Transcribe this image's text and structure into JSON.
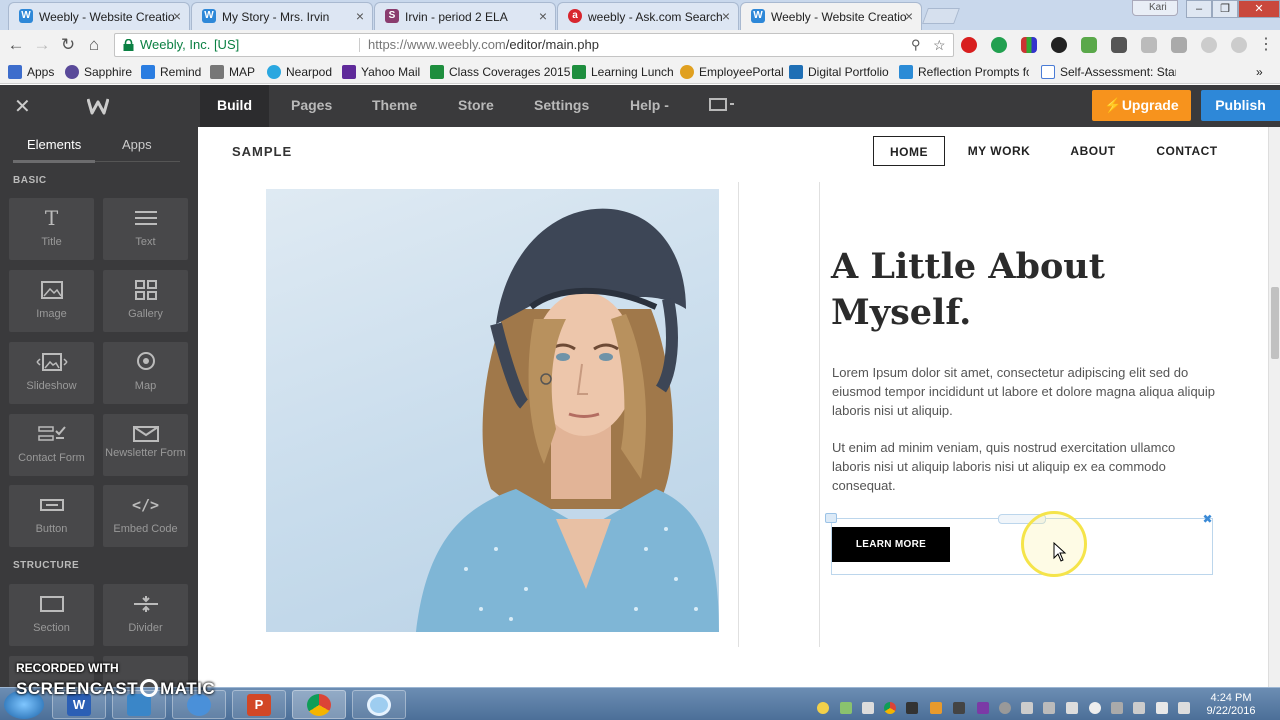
{
  "browser": {
    "tabs": [
      {
        "title": "Weebly - Website Creatio",
        "favicon": "weebly-favicon",
        "color": "#2e88d8"
      },
      {
        "title": "My Story - Mrs. Irvin",
        "favicon": "weebly-favicon",
        "color": "#2e88d8"
      },
      {
        "title": "Irvin - period 2 ELA",
        "favicon": "schoology-favicon",
        "color": "#8a3c6e"
      },
      {
        "title": "weebly - Ask.com Search",
        "favicon": "ask-favicon",
        "color": "#d8262e"
      },
      {
        "title": "Weebly - Website Creatio",
        "favicon": "weebly-favicon",
        "color": "#2e88d8"
      }
    ],
    "user_label": "Kari",
    "address": {
      "secure_label": "Weebly, Inc. [US]",
      "url_base": "https://www.weebly.com",
      "url_path": "/editor/main.php"
    },
    "bookmarks": [
      {
        "label": "Apps",
        "icon": "apps-grid-icon",
        "color": "#3d6dcc"
      },
      {
        "label": "Sapphire",
        "icon": "sapphire-icon",
        "color": "#5a4a9a"
      },
      {
        "label": "Remind",
        "icon": "remind-icon",
        "color": "#2a7de1"
      },
      {
        "label": "MAP",
        "icon": "map-bars-icon",
        "color": "#777777"
      },
      {
        "label": "Nearpod",
        "icon": "nearpod-icon",
        "color": "#2aa7e0"
      },
      {
        "label": "Yahoo Mail",
        "icon": "yahoo-mail-icon",
        "color": "#5f2a9a"
      },
      {
        "label": "Class Coverages 2015",
        "icon": "sheets-icon",
        "color": "#1e8e3e"
      },
      {
        "label": "Learning Lunch",
        "icon": "sheets-icon",
        "color": "#1e8e3e"
      },
      {
        "label": "EmployeePortal",
        "icon": "portal-icon",
        "color": "#e0a020"
      },
      {
        "label": "Digital Portfolio",
        "icon": "portfolio-icon",
        "color": "#1f6fb5"
      },
      {
        "label": "Reflection Prompts fo",
        "icon": "prompts-icon",
        "color": "#2b8bd6"
      },
      {
        "label": "Self-Assessment: Stan",
        "icon": "doc-icon",
        "color": "#4a7cd6"
      }
    ]
  },
  "editor": {
    "nav": [
      "Build",
      "Pages",
      "Theme",
      "Store",
      "Settings",
      "Help -"
    ],
    "upgrade_label": "Upgrade",
    "publish_label": "Publish"
  },
  "sidebar": {
    "tabs": [
      "Elements",
      "Apps"
    ],
    "sections": {
      "basic": "BASIC",
      "structure": "STRUCTURE"
    },
    "basic_items": [
      {
        "label": "Title",
        "icon": "title-icon"
      },
      {
        "label": "Text",
        "icon": "text-lines-icon"
      },
      {
        "label": "Image",
        "icon": "image-icon"
      },
      {
        "label": "Gallery",
        "icon": "gallery-icon"
      },
      {
        "label": "Slideshow",
        "icon": "slideshow-icon"
      },
      {
        "label": "Map",
        "icon": "map-pin-icon"
      },
      {
        "label": "Contact Form",
        "icon": "contact-form-icon"
      },
      {
        "label": "Newsletter Form",
        "icon": "envelope-icon"
      },
      {
        "label": "Button",
        "icon": "button-icon"
      },
      {
        "label": "Embed Code",
        "icon": "code-icon"
      }
    ],
    "structure_items": [
      {
        "label": "Section",
        "icon": "section-icon"
      },
      {
        "label": "Divider",
        "icon": "divider-icon"
      }
    ]
  },
  "site": {
    "title": "SAMPLE",
    "nav": [
      "HOME",
      "MY WORK",
      "ABOUT",
      "CONTACT"
    ],
    "heading": "A Little About Myself.",
    "paragraph1": "Lorem Ipsum dolor sit amet, consectetur adipiscing elit sed do eiusmod tempor incididunt ut labore et dolore magna aliqua aliquip laboris nisi ut aliquip.",
    "paragraph2": "Ut enim ad minim veniam, quis nostrud exercitation ullamco laboris nisi ut aliquip laboris nisi ut aliquip ex ea commodo consequat.",
    "button_label": "LEARN MORE"
  },
  "taskbar": {
    "time": "4:24 PM",
    "date": "9/22/2016"
  },
  "watermark": {
    "line1": "RECORDED WITH",
    "line2a": "SCREENCAST",
    "line2b": "MATIC"
  }
}
